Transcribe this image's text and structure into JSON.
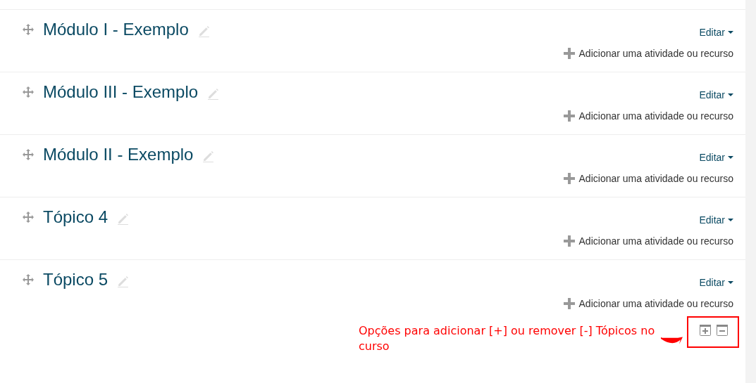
{
  "sections": [
    {
      "title": "Módulo I - Exemplo",
      "edit_menu": "Editar",
      "add_link": "Adicionar uma atividade ou recurso"
    },
    {
      "title": "Módulo III - Exemplo",
      "edit_menu": "Editar",
      "add_link": "Adicionar uma atividade ou recurso"
    },
    {
      "title": "Módulo II - Exemplo",
      "edit_menu": "Editar",
      "add_link": "Adicionar uma atividade ou recurso"
    },
    {
      "title": "Tópico 4",
      "edit_menu": "Editar",
      "add_link": "Adicionar uma atividade ou recurso"
    },
    {
      "title": "Tópico 5",
      "edit_menu": "Editar",
      "add_link": "Adicionar uma atividade ou recurso"
    }
  ],
  "annotation": {
    "text": "Opções para adicionar [+] ou remover [-] Tópicos no curso"
  }
}
